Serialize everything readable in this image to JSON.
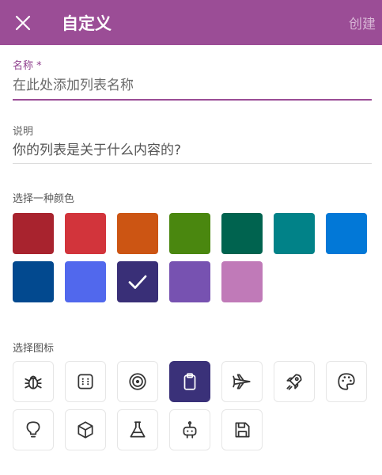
{
  "header": {
    "title": "自定义",
    "create_label": "创建"
  },
  "name_field": {
    "label": "名称 *",
    "placeholder": "在此处添加列表名称",
    "value": ""
  },
  "description_field": {
    "label": "说明",
    "placeholder": "你的列表是关于什么内容的?",
    "value": ""
  },
  "color_section": {
    "label": "选择一种颜色",
    "selected_index": 9,
    "colors": [
      "#a8232e",
      "#d2343b",
      "#cc5513",
      "#4a870f",
      "#00634f",
      "#018288",
      "#0278d7",
      "#02498f",
      "#5168ed",
      "#392f77",
      "#7752b1",
      "#c07ab8"
    ]
  },
  "icon_section": {
    "label": "选择图标",
    "selected_index": 3,
    "icons": [
      "bug-icon",
      "dice-icon",
      "target-icon",
      "clipboard-icon",
      "airplane-icon",
      "rocket-icon",
      "palette-icon",
      "lightbulb-icon",
      "cube-icon",
      "flask-icon",
      "robot-icon",
      "save-icon"
    ]
  }
}
